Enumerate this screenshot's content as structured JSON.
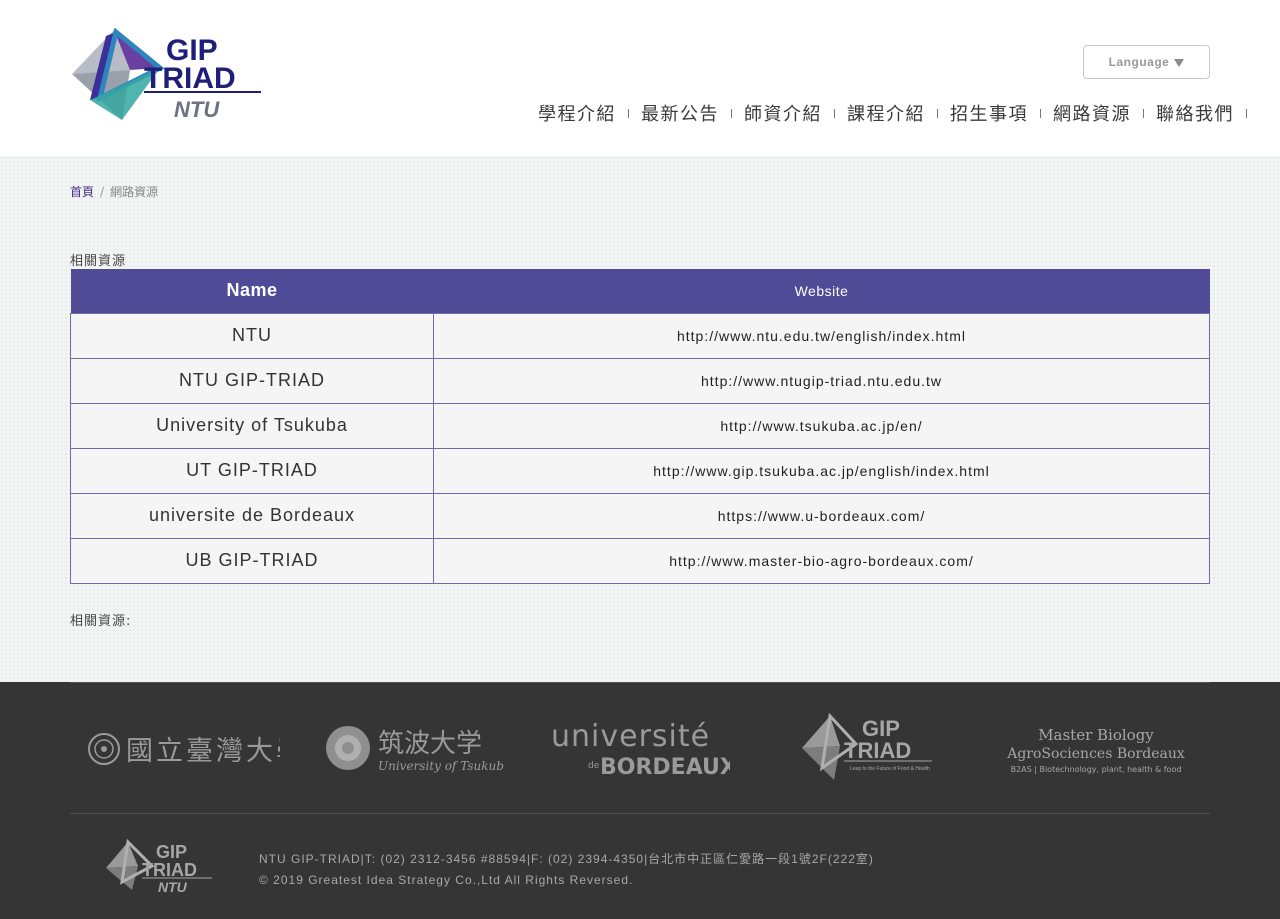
{
  "header": {
    "logo": {
      "line1": "GIP",
      "line2": "TRIAD",
      "line3": "NTU"
    },
    "language_label": "Language",
    "nav": [
      {
        "label": "學程介紹"
      },
      {
        "label": "最新公告"
      },
      {
        "label": "師資介紹"
      },
      {
        "label": "課程介紹"
      },
      {
        "label": "招生事項"
      },
      {
        "label": "網路資源"
      },
      {
        "label": "聯絡我們"
      }
    ]
  },
  "breadcrumb": {
    "home": "首頁",
    "separator": "/",
    "current": "網路資源"
  },
  "main": {
    "section_title": "相關資源",
    "table": {
      "headers": [
        "Name",
        "Website"
      ],
      "rows": [
        {
          "name": "NTU",
          "website": "http://www.ntu.edu.tw/english/index.html"
        },
        {
          "name": "NTU GIP-TRIAD",
          "website": "http://www.ntugip-triad.ntu.edu.tw"
        },
        {
          "name": "University of Tsukuba",
          "website": "http://www.tsukuba.ac.jp/en/"
        },
        {
          "name": "UT GIP-TRIAD",
          "website": "http://www.gip.tsukuba.ac.jp/english/index.html"
        },
        {
          "name": "universite de Bordeaux",
          "website": "https://www.u-bordeaux.com/"
        },
        {
          "name": "UB GIP-TRIAD",
          "website": "http://www.master-bio-agro-bordeaux.com/"
        }
      ]
    },
    "section_footer": "相關資源:"
  },
  "footer": {
    "partners": [
      {
        "icon": "ntu-logo",
        "text": "國立臺灣大學"
      },
      {
        "icon": "tsukuba-logo",
        "text_main": "筑波大学",
        "text_sub": "University of Tsukuba"
      },
      {
        "icon": "bordeaux-logo",
        "text_main": "université",
        "text_de": "de",
        "text_sub": "BORDEAUX"
      },
      {
        "icon": "gip-triad-logo",
        "text_main": "GIP",
        "text_sub": "TRIAD",
        "tagline": "Leap to the Future of Food & Health"
      },
      {
        "icon": "master-bio-logo",
        "line1": "Master Biology",
        "line2": "AgroSociences Bordeaux",
        "line3": "B2AS | Biotechnology, plant, health & food"
      }
    ],
    "logo": {
      "line1": "GIP",
      "line2": "TRIAD",
      "line3": "NTU"
    },
    "contact": "NTU GIP-TRIAD|T: (02) 2312-3456 #88594|F: (02) 2394-4350|台北市中正區仁愛路一段1號2F(222室)",
    "copyright": "© 2019 Greatest Idea Strategy Co.,Ltd All Rights Reversed."
  },
  "colors": {
    "brand_purple": "#504b96",
    "logo_navy": "#1f1f7a",
    "footer_bg": "#353535",
    "breadcrumb_link": "#4a2e85"
  }
}
